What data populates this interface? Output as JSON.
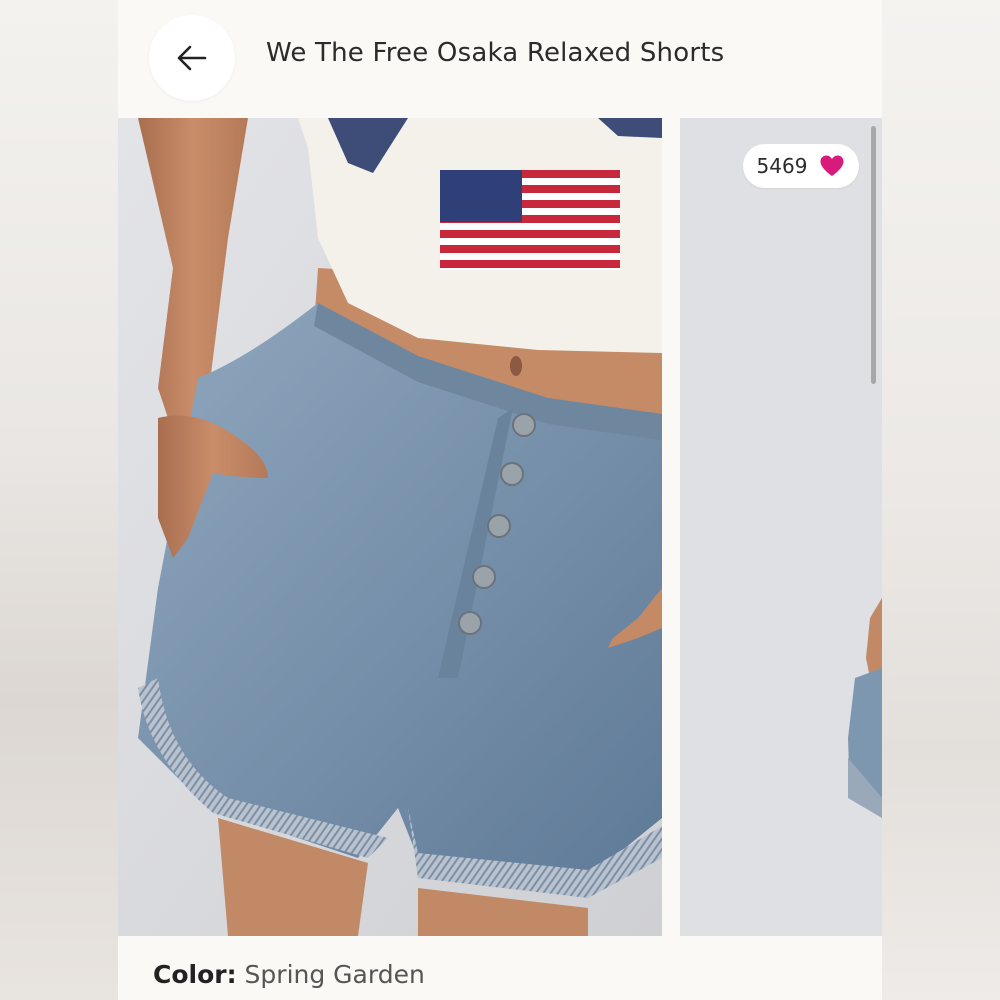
{
  "header": {
    "back_icon": "arrow-left-icon",
    "title": "We The Free Osaka Relaxed Shorts"
  },
  "gallery": {
    "likes": {
      "count": "5469",
      "icon": "heart-icon",
      "color": "#d81b7a"
    }
  },
  "details": {
    "color_label": "Color:",
    "color_value": "Spring Garden"
  }
}
